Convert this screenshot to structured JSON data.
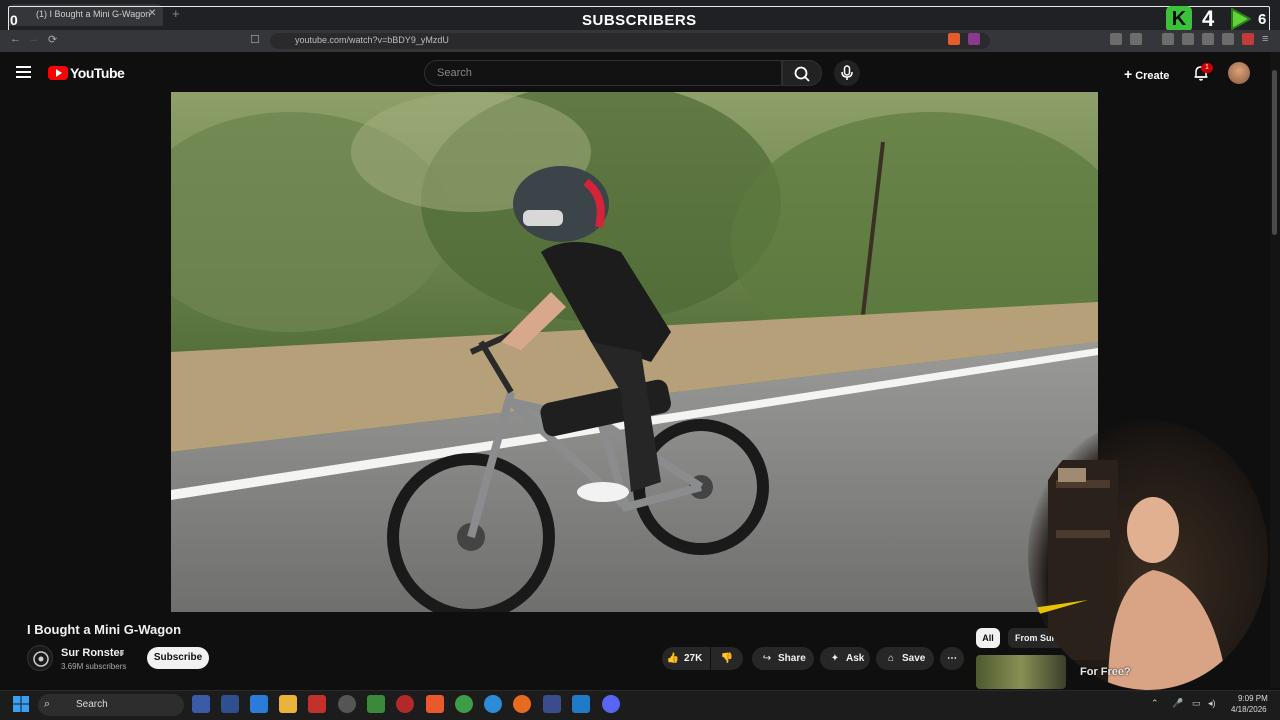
{
  "browser": {
    "tab_title": "(1) I Bought a Mini G-Wagon",
    "url": "youtube.com/watch?v=bBDY9_yMzdU"
  },
  "overlay": {
    "title": "SUBSCRIBERS",
    "left_count": "0",
    "counter_a_value": "4",
    "counter_b_value": "6",
    "accent_green": "#39c23a"
  },
  "youtube": {
    "logo_text": "YouTube",
    "search_placeholder": "Search",
    "create_label": "Create",
    "notification_count": "1"
  },
  "video": {
    "title": "I Bought a Mini G-Wagon",
    "channel_name": "Sur Ronster",
    "channel_subs": "3.69M subscribers",
    "subscribe_label": "Subscribe",
    "likes": "27K",
    "share_label": "Share",
    "ask_label": "Ask",
    "save_label": "Save"
  },
  "recommendations": {
    "filter_all": "All",
    "filter_from": "From Sur R",
    "thumb_label": "For Free?"
  },
  "taskbar": {
    "search_label": "Search",
    "time": "9:09 PM",
    "date": "4/18/2026"
  }
}
